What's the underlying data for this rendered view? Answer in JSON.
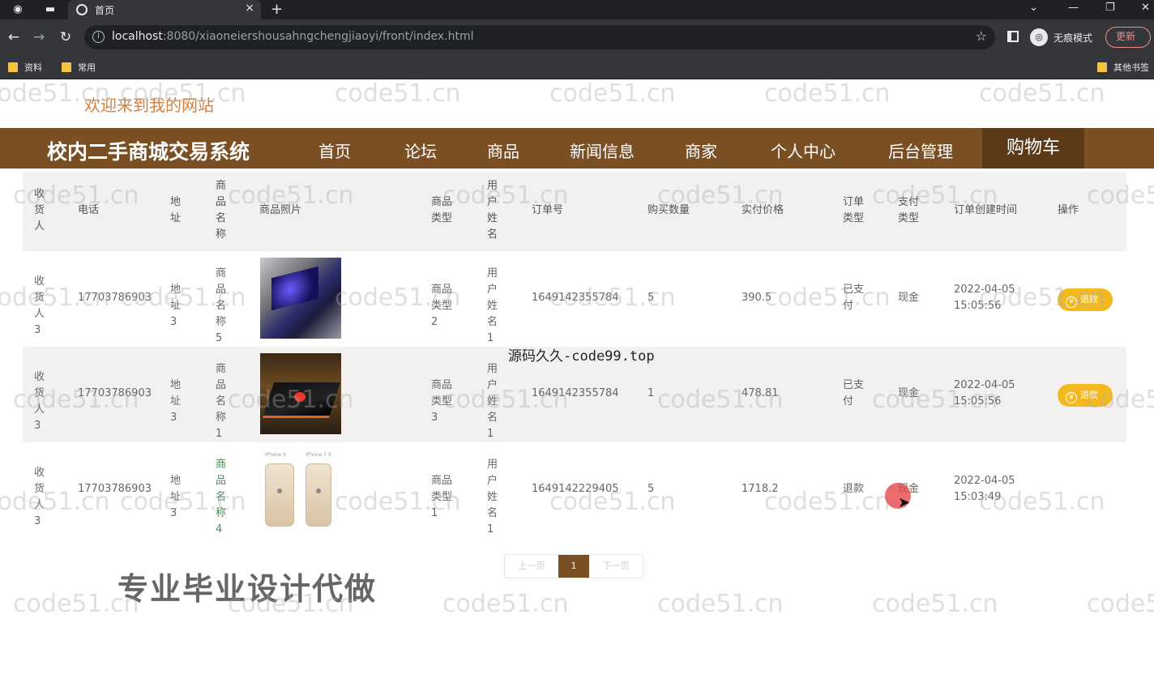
{
  "browser": {
    "tab_title": "首页",
    "url_host": "localhost",
    "url_rest": ":8080/xiaoneiershousahngchengjiaoyi/front/index.html",
    "incognito_label": "无痕模式",
    "update_label": "更新",
    "bookmarks": [
      "资料",
      "常用"
    ],
    "other_bookmarks": "其他书签"
  },
  "site": {
    "welcome": "欢迎来到我的网站",
    "name": "校内二手商城交易系统",
    "nav": [
      "首页",
      "论坛",
      "商品",
      "新闻信息",
      "商家",
      "个人中心",
      "后台管理",
      "购物车"
    ]
  },
  "table": {
    "headers": {
      "receiver": "收货人",
      "phone": "电话",
      "address": "地址",
      "product_name": "商品名称",
      "product_photo": "商品照片",
      "product_type": "商品类型",
      "user_name": "用户姓名",
      "order_no": "订单号",
      "quantity": "购买数量",
      "price": "实付价格",
      "order_type": "订单类型",
      "pay_type": "支付类型",
      "created": "订单创建时间",
      "action": "操作"
    },
    "rows": [
      {
        "receiver": "收货人3",
        "phone": "17703786903",
        "address": "地址3",
        "product_name": "商品名称5",
        "product_type": "商品类型2",
        "user_name": "用户姓名1",
        "order_no": "1649142355784",
        "quantity": "5",
        "price": "390.5",
        "order_type": "已支付",
        "pay_type": "现金",
        "created_date": "2022-04-05",
        "created_time": "15:05:56",
        "action": "退款"
      },
      {
        "receiver": "收货人3",
        "phone": "17703786903",
        "address": "地址3",
        "product_name": "商品名称1",
        "product_type": "商品类型3",
        "user_name": "用户姓名1",
        "order_no": "1649142355784",
        "quantity": "1",
        "price": "478.81",
        "order_type": "已支付",
        "pay_type": "现金",
        "created_date": "2022-04-05",
        "created_time": "15:05:56",
        "action": "退款"
      },
      {
        "receiver": "收货人3",
        "phone": "17703786903",
        "address": "地址3",
        "product_name": "商品名称4",
        "product_type": "商品类型1",
        "user_name": "用户姓名1",
        "order_no": "1649142229405",
        "quantity": "5",
        "price": "1718.2",
        "order_type": "退款",
        "pay_type": "现金",
        "created_date": "2022-04-05",
        "created_time": "15:03:49",
        "action": ""
      }
    ]
  },
  "pager": {
    "prev": "上一页",
    "current": "1",
    "next": "下一页"
  },
  "overlay_caption": "源码久久-code99.top",
  "promo": "专业毕业设计代做",
  "watermark": "code51.cn",
  "phone_labels": [
    "iPhone 6",
    "iPhone 7 S"
  ]
}
